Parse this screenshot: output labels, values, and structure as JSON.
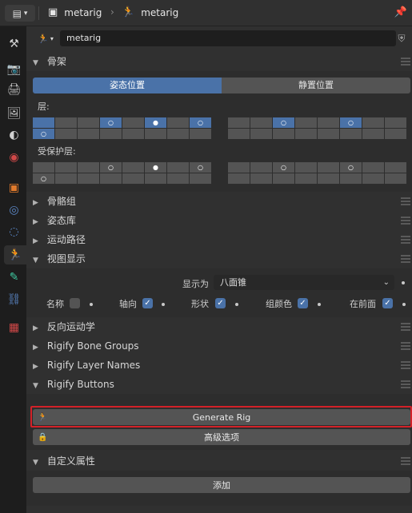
{
  "header": {
    "editor_icon": "properties-editor-icon",
    "crumbs": [
      {
        "icon": "object-icon",
        "label": "metarig"
      },
      {
        "icon": "armature-data-icon",
        "label": "metarig"
      }
    ],
    "pin_icon": "pin-icon"
  },
  "tabs": [
    {
      "icon": "tool-icon",
      "glyph": "⚒",
      "color": "#d0d0d0"
    },
    {
      "icon": "render-icon",
      "glyph": "📷",
      "color": "#c8c8c8"
    },
    {
      "icon": "output-icon",
      "glyph": "🖨",
      "color": "#c8c8c8"
    },
    {
      "icon": "view-layer-icon",
      "glyph": "🖼",
      "color": "#c8c8c8"
    },
    {
      "icon": "scene-icon",
      "glyph": "◐",
      "color": "#d0d0d0"
    },
    {
      "icon": "world-icon",
      "glyph": "◉",
      "color": "#d04848"
    },
    {
      "icon": "object-icon",
      "glyph": "▣",
      "color": "#e07a2c"
    },
    {
      "icon": "modifier-icon",
      "glyph": "◎",
      "color": "#5c88c8"
    },
    {
      "icon": "physics-icon",
      "glyph": "◌",
      "color": "#5c88c8"
    },
    {
      "icon": "armature-data-icon",
      "glyph": "🏃",
      "color": "#3ec8a0",
      "active": true
    },
    {
      "icon": "bone-icon",
      "glyph": "✎",
      "color": "#3ec8a0"
    },
    {
      "icon": "bone-constraint-icon",
      "glyph": "⛓",
      "color": "#5c88c8"
    },
    {
      "icon": "texture-icon",
      "glyph": "▦",
      "color": "#d04848"
    }
  ],
  "object": {
    "name": "metarig"
  },
  "skeleton": {
    "title": "骨架",
    "pose_position": "姿态位置",
    "rest_position": "静置位置",
    "layers_label": "层:",
    "protected_label": "受保护层:"
  },
  "collapsed_panels": [
    {
      "title": "骨骼组"
    },
    {
      "title": "姿态库"
    },
    {
      "title": "运动路径"
    }
  ],
  "viewport_display": {
    "title": "视图显示",
    "display_as_label": "显示为",
    "display_as_value": "八面锥",
    "checks": [
      {
        "label": "名称",
        "checked": false
      },
      {
        "label": "轴向",
        "checked": true
      },
      {
        "label": "形状",
        "checked": true
      },
      {
        "label": "组颜色",
        "checked": true
      },
      {
        "label": "在前面",
        "checked": true
      }
    ]
  },
  "panels2": [
    {
      "title": "反向运动学"
    },
    {
      "title": "Rigify Bone Groups"
    },
    {
      "title": "Rigify Layer Names"
    }
  ],
  "rigify_buttons": {
    "title": "Rigify Buttons",
    "generate": "Generate Rig",
    "advanced": "高级选项"
  },
  "custom_props": {
    "title": "自定义属性",
    "add": "添加"
  },
  "colors": {
    "accent": "#4a72a8",
    "highlight": "#d32128"
  }
}
